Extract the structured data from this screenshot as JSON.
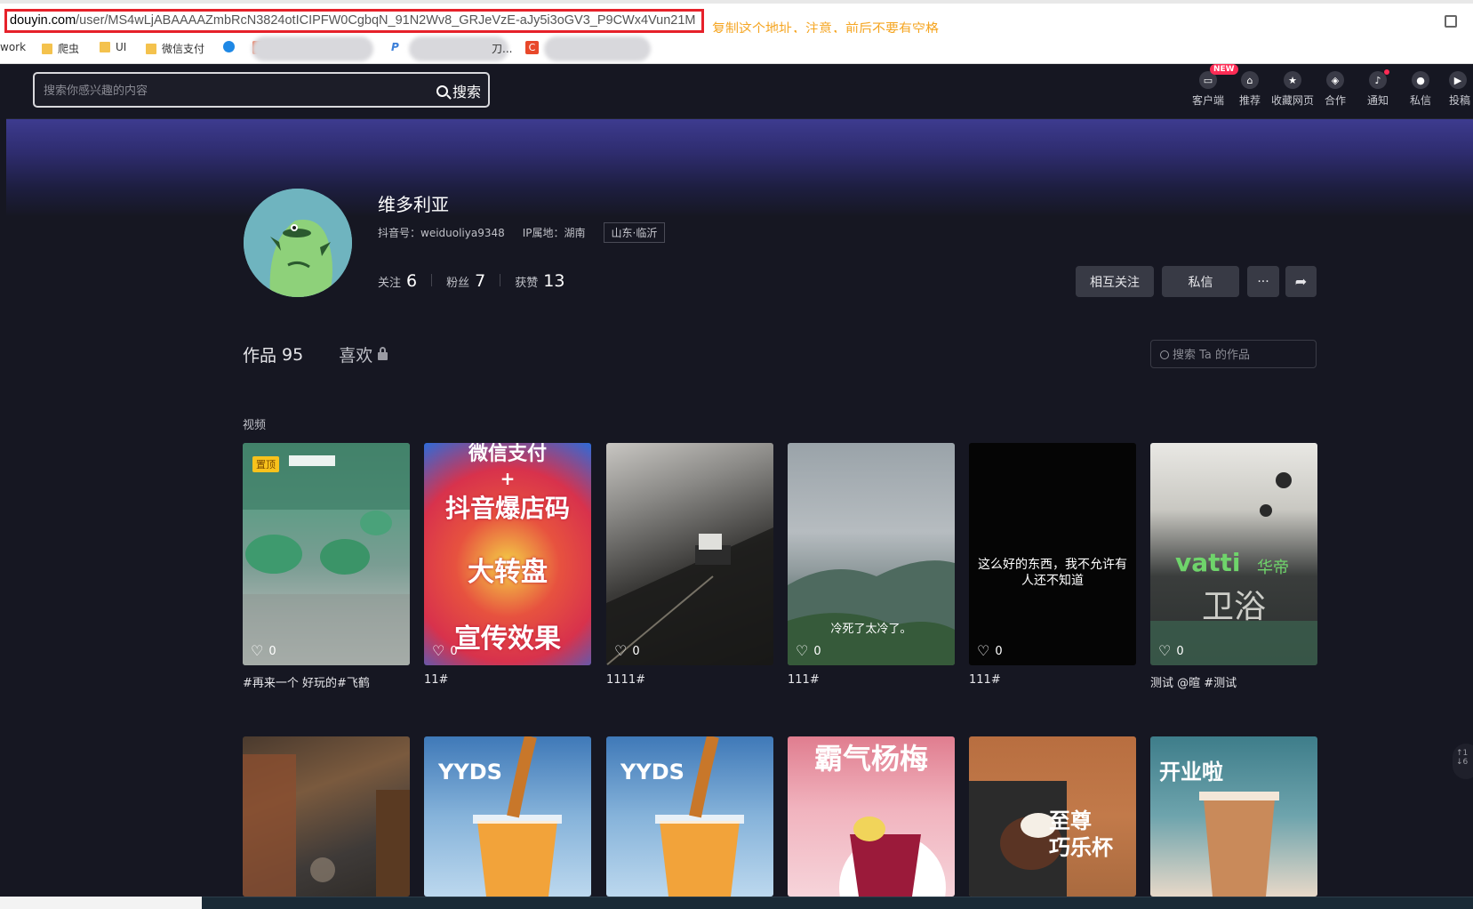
{
  "browser": {
    "url_domain": "douyin.com",
    "url_path": "/user/MS4wLjABAAAAZmbRcN3824otICIPFW0CgbqN_91N2Wv8_GRJeVzE-aJy5i3oGV3_P9CWx4Vun21M",
    "annotation": "复制这个地址，注意，前后不要有空格",
    "bookmarks": [
      "work",
      "爬虫",
      "UI",
      "微信支付",
      "刀..."
    ]
  },
  "header": {
    "search_placeholder": "搜索你感兴趣的内容",
    "search_button": "搜索",
    "nav": [
      {
        "label": "客户端",
        "badge": "NEW"
      },
      {
        "label": "推荐"
      },
      {
        "label": "收藏网页"
      },
      {
        "label": "合作"
      },
      {
        "label": "通知"
      },
      {
        "label": "私信"
      },
      {
        "label": "投稿"
      }
    ]
  },
  "profile": {
    "name": "维多利亚",
    "douyin_id": "抖音号：weiduoliya9348",
    "ip": "IP属地：湖南",
    "location_tag": "山东·临沂",
    "stats": [
      {
        "label": "关注",
        "value": "6"
      },
      {
        "label": "粉丝",
        "value": "7"
      },
      {
        "label": "获赞",
        "value": "13"
      }
    ],
    "actions": {
      "follow": "相互关注",
      "message": "私信",
      "more": "···",
      "share": "➦"
    }
  },
  "tabs": {
    "works_label": "作品",
    "works_count": "95",
    "liked_label": "喜欢"
  },
  "works_search_placeholder": "搜索 Ta 的作品",
  "section_label": "视频",
  "videos": [
    {
      "caption": "#再来一个 好玩的#飞鹤",
      "likes": "0",
      "pinned": "置顶"
    },
    {
      "caption": "11#",
      "likes": "0",
      "text1": "微信支付",
      "text2": "抖音爆店码",
      "text3": "大转盘",
      "text4": "宣传效果"
    },
    {
      "caption": "1111#",
      "likes": "0"
    },
    {
      "caption": "111#",
      "likes": "0",
      "overlay": "冷死了太冷了。"
    },
    {
      "caption": "111#",
      "likes": "0",
      "overlay": "这么好的东西，我不允许有人还不知道"
    },
    {
      "caption": "测试 @暄 #测试",
      "likes": "0",
      "brand": "vatti",
      "brand2": "华帝",
      "sub": "卫浴"
    },
    {
      "caption": ""
    },
    {
      "caption": "",
      "text1": "YYDS"
    },
    {
      "caption": "",
      "text1": "YYDS"
    },
    {
      "caption": "",
      "text1": "霸气杨梅"
    },
    {
      "caption": "",
      "text1": "至尊",
      "text2": "巧乐杯"
    },
    {
      "caption": "",
      "text1": "开业啦"
    }
  ],
  "colors": {
    "bg": "#161722",
    "accent": "#fe2c55",
    "url_highlight": "#e6212a",
    "annotation": "#f5a623"
  }
}
